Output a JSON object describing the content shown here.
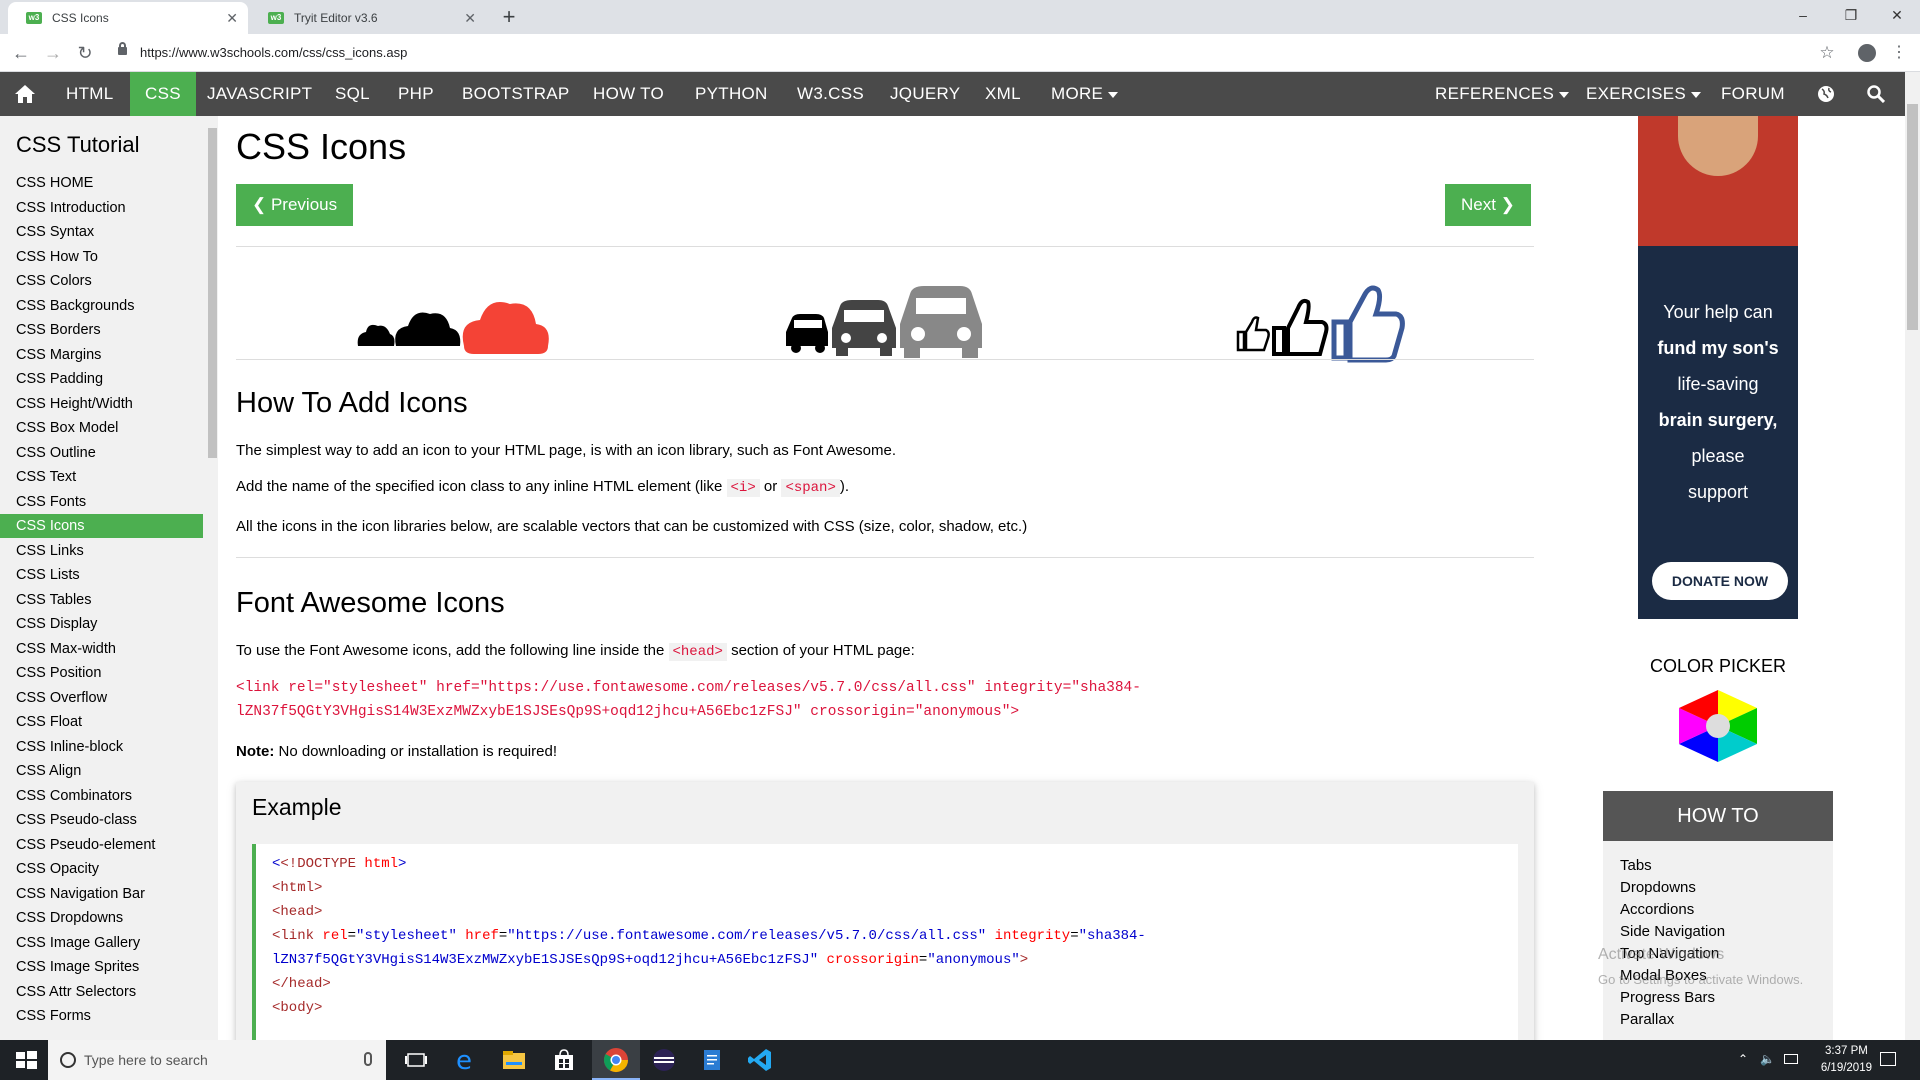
{
  "browser": {
    "tabs": [
      {
        "title": "CSS Icons",
        "active": true
      },
      {
        "title": "Tryit Editor v3.6",
        "active": false
      }
    ],
    "new_tab": "+",
    "url": "https://www.w3schools.com/css/css_icons.asp",
    "window_controls": [
      "–",
      "❐",
      "✕"
    ]
  },
  "topnav": {
    "home_icon": "home-icon",
    "items": [
      "HTML",
      "CSS",
      "JAVASCRIPT",
      "SQL",
      "PHP",
      "BOOTSTRAP",
      "HOW TO",
      "PYTHON",
      "W3.CSS",
      "JQUERY",
      "XML",
      "MORE"
    ],
    "active": "CSS",
    "right_items": [
      "REFERENCES",
      "EXERCISES",
      "FORUM"
    ]
  },
  "sidebar": {
    "title": "CSS Tutorial",
    "items": [
      "CSS HOME",
      "CSS Introduction",
      "CSS Syntax",
      "CSS How To",
      "CSS Colors",
      "CSS Backgrounds",
      "CSS Borders",
      "CSS Margins",
      "CSS Padding",
      "CSS Height/Width",
      "CSS Box Model",
      "CSS Outline",
      "CSS Text",
      "CSS Fonts",
      "CSS Icons",
      "CSS Links",
      "CSS Lists",
      "CSS Tables",
      "CSS Display",
      "CSS Max-width",
      "CSS Position",
      "CSS Overflow",
      "CSS Float",
      "CSS Inline-block",
      "CSS Align",
      "CSS Combinators",
      "CSS Pseudo-class",
      "CSS Pseudo-element",
      "CSS Opacity",
      "CSS Navigation Bar",
      "CSS Dropdowns",
      "CSS Image Gallery",
      "CSS Image Sprites",
      "CSS Attr Selectors",
      "CSS Forms"
    ],
    "active": "CSS Icons"
  },
  "main": {
    "title": "CSS Icons",
    "prev": "❮ Previous",
    "next": "Next ❯",
    "icon_colors": {
      "cloud_red": "#f44336",
      "car_dark": "#444444",
      "car_grey": "#888888",
      "thumb_blue": "#3b5998"
    },
    "h2_add": "How To Add Icons",
    "p1": "The simplest way to add an icon to your HTML page, is with an icon library, such as Font Awesome.",
    "p2_a": "Add the name of the specified icon class to any inline HTML element (like ",
    "p2_code1": "<i>",
    "p2_or": " or ",
    "p2_code2": "<span>",
    "p2_end": ").",
    "p3": "All the icons in the icon libraries below, are scalable vectors that can be customized with CSS (size, color, shadow, etc.)",
    "h2_fa": "Font Awesome Icons",
    "p4_a": "To use the Font Awesome icons, add the following line inside the ",
    "p4_code": "<head>",
    "p4_end": " section of your HTML page:",
    "link_line1": "<link rel=\"stylesheet\" href=\"https://use.fontawesome.com/releases/v5.7.0/css/all.css\" integrity=\"sha384-",
    "link_line2": "lZN37f5QGtY3VHgisS14W3ExzMWZxybE1SJSEsQp9S+oqd12jhcu+A56Ebc1zFSJ\" crossorigin=\"anonymous\">",
    "note_label": "Note:",
    "note_text": " No downloading or installation is required!",
    "example": {
      "title": "Example",
      "doctype": "<!DOCTYPE ",
      "doctype_html": "html",
      "doctype_end": ">",
      "html": "<html>",
      "head": "<head>",
      "link_open": "<link ",
      "rel_attr": "rel",
      "rel_val": "\"stylesheet\"",
      "href_attr": " href",
      "href_val": "\"https://use.fontawesome.com/releases/v5.7.0/css/all.css\"",
      "integ_attr": " integrity",
      "integ_val1": "\"sha384-",
      "integ_val2": "lZN37f5QGtY3VHgisS14W3ExzMWZxybE1SJSEsQp9S+oqd12jhcu+A56Ebc1zFSJ\"",
      "cross_attr": " crossorigin",
      "cross_val": "\"anonymous\"",
      "link_close": ">",
      "head_close": "</head>",
      "body": "<body>"
    }
  },
  "ad": {
    "line1": "Your help can",
    "line2": "fund my son's",
    "line3": "life-saving",
    "line4": "brain surgery,",
    "line5": "please",
    "line6": "support",
    "button": "DONATE NOW"
  },
  "color_picker": {
    "title": "COLOR PICKER"
  },
  "howto": {
    "title": "HOW TO",
    "items": [
      "Tabs",
      "Dropdowns",
      "Accordions",
      "Side Navigation",
      "Top Navigation",
      "Modal Boxes",
      "Progress Bars",
      "Parallax"
    ]
  },
  "watermark": {
    "line1": "Activate Windows",
    "line2": "Go to Settings to activate Windows."
  },
  "taskbar": {
    "search_placeholder": "Type here to search",
    "time": "3:37 PM",
    "date": "6/19/2019"
  }
}
